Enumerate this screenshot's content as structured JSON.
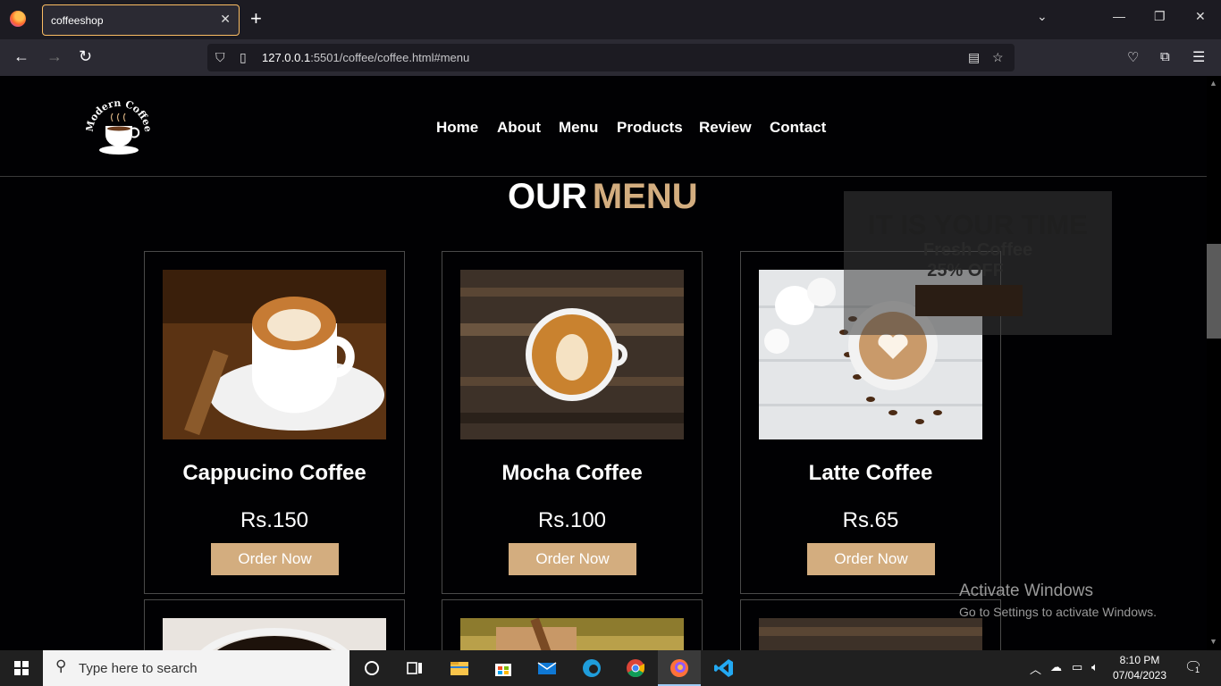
{
  "browser": {
    "tab_title": "coffeeshop",
    "tab_close": "✕",
    "new_tab": "+",
    "url_host": "127.0.0.1",
    "url_rest": ":5501/coffee/coffee.html#menu"
  },
  "site": {
    "logo_text": "Modern Coffee",
    "nav": [
      "Home",
      "About",
      "Menu",
      "Products",
      "Review",
      "Contact"
    ],
    "section_title_1": "OUR",
    "section_title_2": "MENU",
    "promo": {
      "line1": "IT IS YOUR TIME",
      "line2": "Fresh Coffee",
      "line3": "25% OFF"
    },
    "menu_items": [
      {
        "name": "Cappucino Coffee",
        "price": "Rs.150",
        "button": "Order Now"
      },
      {
        "name": "Mocha Coffee",
        "price": "Rs.100",
        "button": "Order Now"
      },
      {
        "name": "Latte Coffee",
        "price": "Rs.65",
        "button": "Order Now"
      }
    ]
  },
  "watermark": {
    "line1": "Activate Windows",
    "line2": "Go to Settings to activate Windows."
  },
  "taskbar": {
    "search_placeholder": "Type here to search",
    "time": "8:10 PM",
    "date": "07/04/2023",
    "notification_count": "1"
  },
  "colors": {
    "accent": "#d3ad7f",
    "background": "#010103",
    "browser_tab_border": "#fbbd63"
  }
}
